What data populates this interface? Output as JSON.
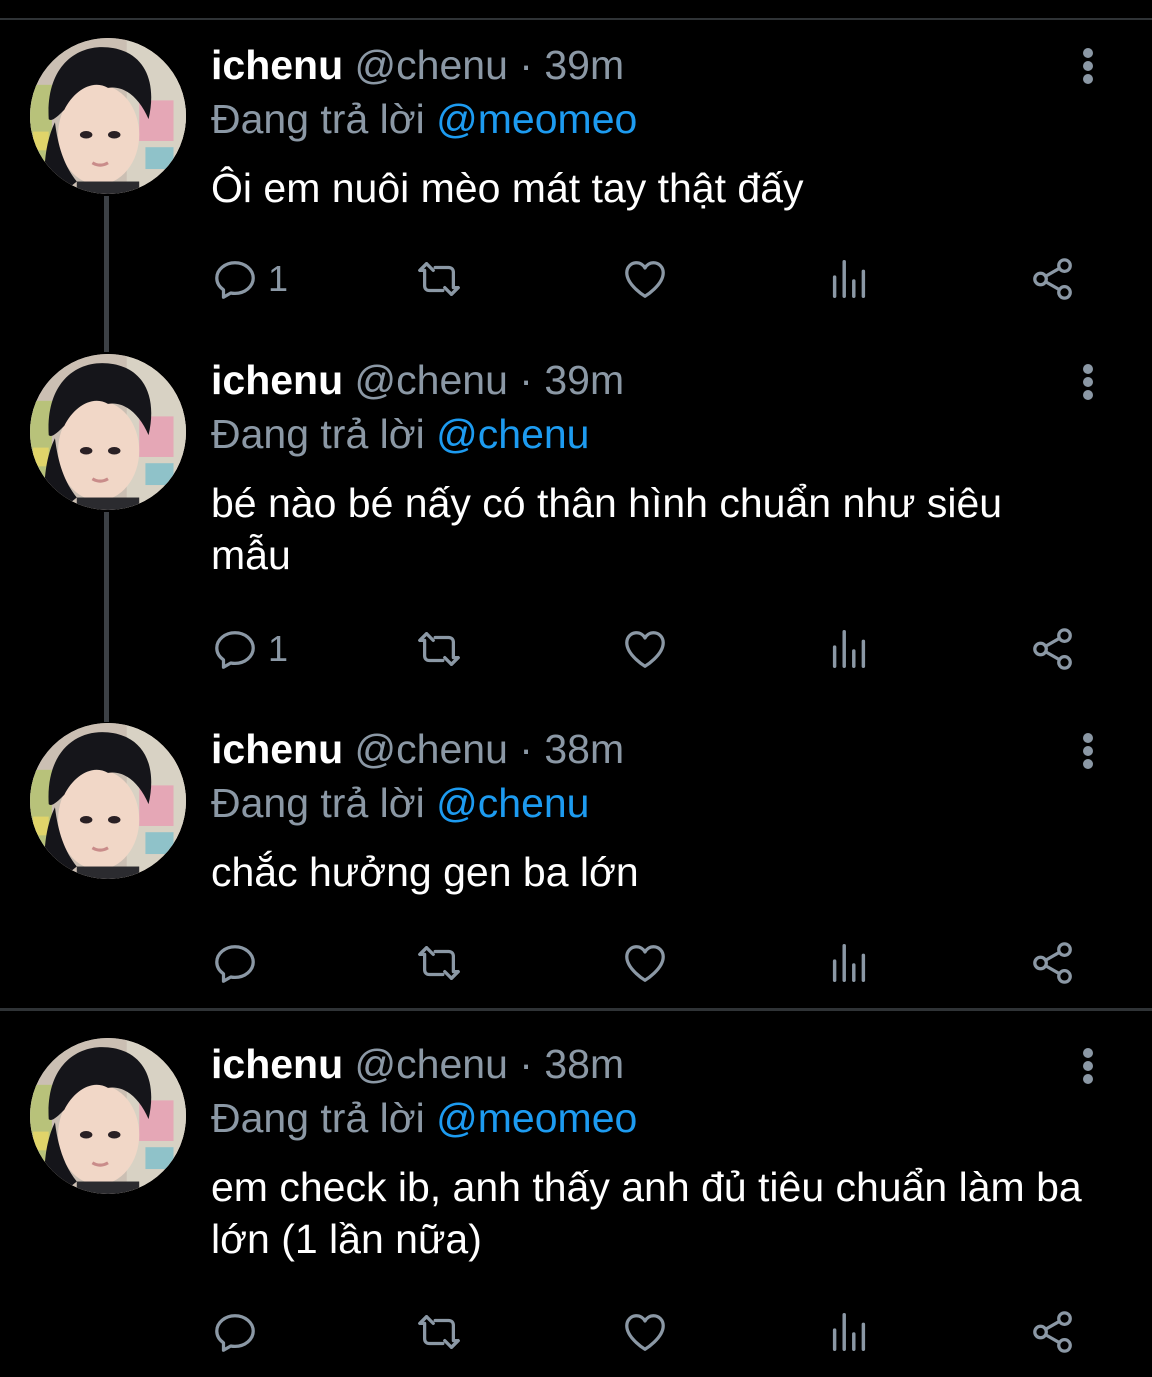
{
  "colors": {
    "background": "#000000",
    "text_primary": "#ffffff",
    "text_secondary": "#8b98a5",
    "mention": "#1d9bf0",
    "thread_line": "#3c4045",
    "divider": "#2f3336"
  },
  "icons": {
    "reply": "speech-bubble-icon",
    "retweet": "retweet-arrows-icon",
    "like": "heart-icon",
    "views": "bar-chart-icon",
    "share": "share-nodes-icon",
    "more": "vertical-dots-icon"
  },
  "tweets": [
    {
      "display_name": "ichenu",
      "handle": "@chenu",
      "separator": "·",
      "time": "39m",
      "replying_prefix": "Đang trả lời",
      "replying_to": "@meomeo",
      "text": "Ôi em nuôi mèo mát tay thật đấy",
      "reply_count": "1"
    },
    {
      "display_name": "ichenu",
      "handle": "@chenu",
      "separator": "·",
      "time": "39m",
      "replying_prefix": "Đang trả lời",
      "replying_to": "@chenu",
      "text": "bé nào bé nấy có thân hình chuẩn như siêu mẫu",
      "reply_count": "1"
    },
    {
      "display_name": "ichenu",
      "handle": "@chenu",
      "separator": "·",
      "time": "38m",
      "replying_prefix": "Đang trả lời",
      "replying_to": "@chenu",
      "text": "chắc hưởng gen ba lớn",
      "reply_count": ""
    },
    {
      "display_name": "ichenu",
      "handle": "@chenu",
      "separator": "·",
      "time": "38m",
      "replying_prefix": "Đang trả lời",
      "replying_to": "@meomeo",
      "text": "em check ib, anh thấy anh đủ tiêu chuẩn làm ba lớn (1 lần nữa)",
      "reply_count": ""
    }
  ]
}
